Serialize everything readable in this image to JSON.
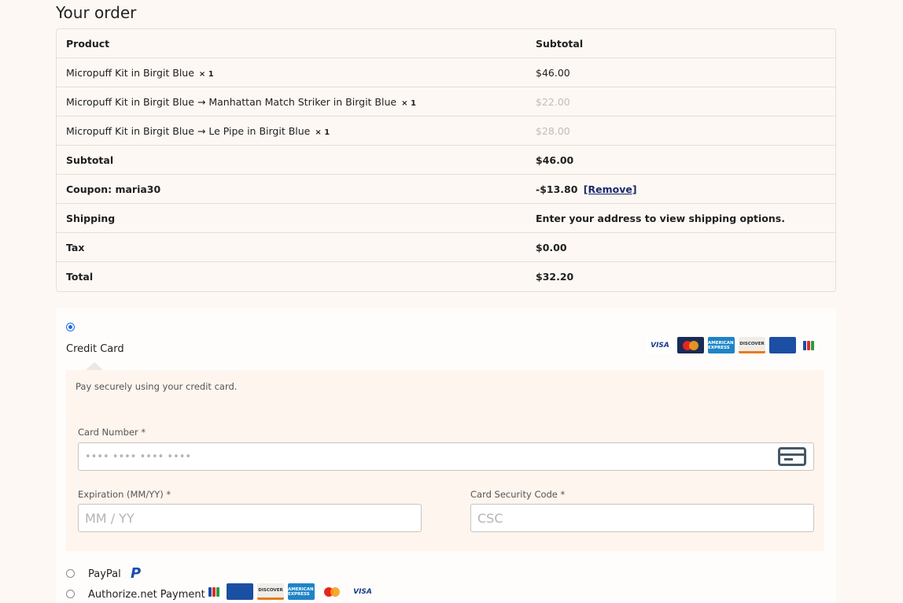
{
  "heading": "Your order",
  "table": {
    "header": {
      "product": "Product",
      "subtotal": "Subtotal"
    },
    "items": [
      {
        "name": "Micropuff Kit in Birgit Blue",
        "qty": "× 1",
        "price": "$46.00",
        "muted": false
      },
      {
        "name": "Micropuff Kit in Birgit Blue → Manhattan Match Striker in Birgit Blue",
        "qty": "× 1",
        "price": "$22.00",
        "muted": true
      },
      {
        "name": "Micropuff Kit in Birgit Blue → Le Pipe in Birgit Blue",
        "qty": "× 1",
        "price": "$28.00",
        "muted": true
      }
    ],
    "subtotal": {
      "label": "Subtotal",
      "value": "$46.00"
    },
    "coupon": {
      "label": "Coupon: maria30",
      "value": "-$13.80",
      "remove": "[Remove]"
    },
    "shipping": {
      "label": "Shipping",
      "value": "Enter your address to view shipping options."
    },
    "tax": {
      "label": "Tax",
      "value": "$0.00"
    },
    "total": {
      "label": "Total",
      "value": "$32.20"
    }
  },
  "payment": {
    "credit_card": {
      "label": "Credit Card",
      "selected": true,
      "description": "Pay securely using your credit card.",
      "card_number_label": "Card Number *",
      "card_number_placeholder": "•••• •••• •••• ••••",
      "expiry_label": "Expiration (MM/YY) *",
      "expiry_placeholder": "MM / YY",
      "csc_label": "Card Security Code *",
      "csc_placeholder": "CSC",
      "logos": [
        "visa",
        "mastercard",
        "amex",
        "discover",
        "diners",
        "jcb"
      ]
    },
    "paypal": {
      "label": "PayPal",
      "selected": false,
      "icon": "paypal-icon"
    },
    "authorize": {
      "label": "Authorize.net Payment",
      "selected": false,
      "logos": [
        "jcb",
        "diners",
        "discover",
        "amex",
        "mastercard",
        "visa"
      ]
    }
  },
  "logo_text": {
    "visa": "VISA",
    "amex": "AMERICAN EXPRESS",
    "discover": "DISCOVER",
    "paypal": "P"
  },
  "colors": {
    "background": "#fdf8f4",
    "link": "#1c2a6b",
    "radio_selected": "#1a6be0",
    "panel": "#fdf5ee"
  }
}
